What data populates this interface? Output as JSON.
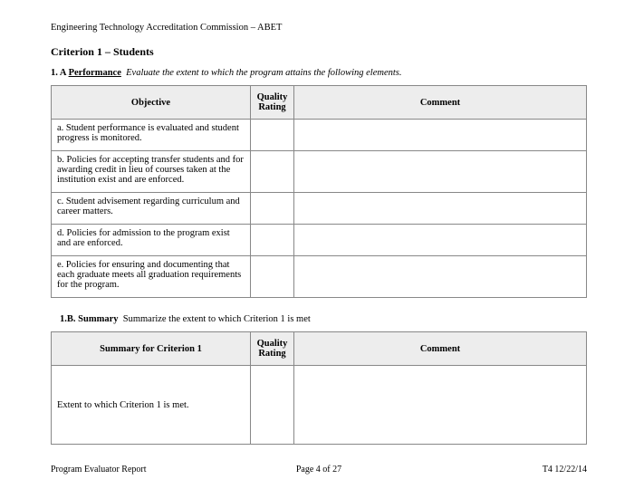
{
  "header": "Engineering Technology Accreditation Commission – ABET",
  "criterion_title": "Criterion 1 – Students",
  "section_a": {
    "label": "1. A",
    "name": "Performance",
    "prompt": "Evaluate the extent to which the program attains the following elements."
  },
  "table_a": {
    "headers": {
      "objective": "Objective",
      "quality": "Quality Rating",
      "comment": "Comment"
    },
    "rows": [
      {
        "obj": "a.  Student performance is evaluated and student progress is monitored.",
        "qr": "",
        "com": ""
      },
      {
        "obj": "b.  Policies for accepting transfer students and for awarding credit in lieu of courses taken at the institution exist and are enforced.",
        "qr": "",
        "com": ""
      },
      {
        "obj": "c.  Student advisement regarding curriculum and career matters.",
        "qr": "",
        "com": ""
      },
      {
        "obj": "d.  Policies for admission to the program exist and are enforced.",
        "qr": "",
        "com": ""
      },
      {
        "obj": "e.  Policies for ensuring and documenting that each graduate meets all graduation requirements for the program.",
        "qr": "",
        "com": ""
      }
    ]
  },
  "section_b": {
    "label": "1.B.",
    "name": "Summary",
    "prompt": "Summarize the extent to which Criterion 1 is met"
  },
  "table_b": {
    "headers": {
      "summary": "Summary for Criterion 1",
      "quality": "Quality Rating",
      "comment": "Comment"
    },
    "row": {
      "text": "Extent to which Criterion 1 is met.",
      "qr": "",
      "com": ""
    }
  },
  "footer": {
    "left": "Program Evaluator Report",
    "center": "Page 4 of 27",
    "right": "T4    12/22/14"
  }
}
